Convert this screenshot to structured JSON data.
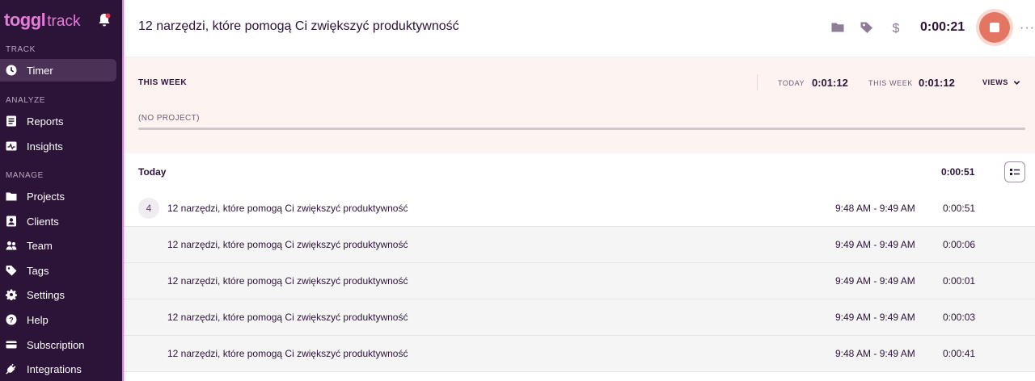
{
  "sidebar": {
    "logo_brand": "toggl",
    "logo_product": "track",
    "sections": {
      "track": "TRACK",
      "analyze": "ANALYZE",
      "manage": "MANAGE"
    },
    "items": [
      {
        "label": "Timer",
        "icon": "clock-icon",
        "active": true
      },
      {
        "label": "Reports",
        "icon": "reports-icon"
      },
      {
        "label": "Insights",
        "icon": "insights-icon"
      },
      {
        "label": "Projects",
        "icon": "folder-icon"
      },
      {
        "label": "Clients",
        "icon": "clients-icon"
      },
      {
        "label": "Team",
        "icon": "team-icon"
      },
      {
        "label": "Tags",
        "icon": "tag-icon"
      },
      {
        "label": "Settings",
        "icon": "gear-icon"
      },
      {
        "label": "Help",
        "icon": "help-icon"
      },
      {
        "label": "Subscription",
        "icon": "card-icon"
      },
      {
        "label": "Integrations",
        "icon": "plug-icon"
      }
    ]
  },
  "timer": {
    "description": "12 narzędzi, które pomogą Ci zwiększyć produktywność",
    "duration": "0:00:21"
  },
  "week": {
    "title": "THIS WEEK",
    "today_label": "TODAY",
    "today_value": "0:01:12",
    "week_label": "THIS WEEK",
    "week_value": "0:01:12",
    "views_label": "VIEWS",
    "project_label": "(NO PROJECT)"
  },
  "today": {
    "label": "Today",
    "total": "0:00:51",
    "group_count": "4",
    "entries": [
      {
        "description": "12 narzędzi, które pomogą Ci zwiększyć produktywność",
        "range": "9:48 AM - 9:49 AM",
        "duration": "0:00:51"
      },
      {
        "description": "12 narzędzi, które pomogą Ci zwiększyć produktywność",
        "range": "9:49 AM - 9:49 AM",
        "duration": "0:00:06"
      },
      {
        "description": "12 narzędzi, które pomogą Ci zwiększyć produktywność",
        "range": "9:49 AM - 9:49 AM",
        "duration": "0:00:01"
      },
      {
        "description": "12 narzędzi, które pomogą Ci zwiększyć produktywność",
        "range": "9:49 AM - 9:49 AM",
        "duration": "0:00:03"
      },
      {
        "description": "12 narzędzi, które pomogą Ci zwiększyć produktywność",
        "range": "9:48 AM - 9:49 AM",
        "duration": "0:00:41"
      }
    ]
  },
  "colors": {
    "sidebar_bg": "#2c1338",
    "accent_pink": "#e57cd8",
    "stop_button": "#e57563"
  }
}
